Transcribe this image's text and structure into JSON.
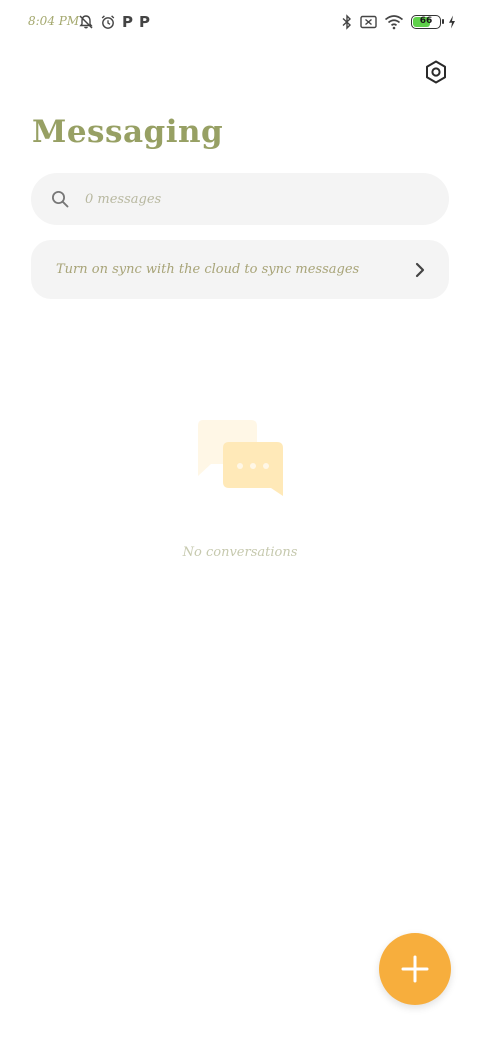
{
  "status_bar": {
    "time": "8:04 PM",
    "battery_level": "66",
    "battery_fraction": 0.66,
    "left_icons": [
      "notifications-off-icon",
      "alarm-icon",
      "p-app-icon",
      "p-app-icon"
    ],
    "right_icons": [
      "bluetooth-icon",
      "no-sim-icon",
      "wifi-icon",
      "battery-icon",
      "charging-icon"
    ]
  },
  "header": {
    "title": "Messaging",
    "settings_icon": "settings-hexagon-icon"
  },
  "search": {
    "placeholder": "0 messages",
    "icon": "search-icon"
  },
  "sync_banner": {
    "text": "Turn on sync with the cloud to sync messages",
    "icon": "chevron-right-icon"
  },
  "empty_state": {
    "text": "No conversations",
    "icon": "chat-bubbles-icon"
  },
  "fab": {
    "icon": "plus-icon"
  },
  "colors": {
    "title": "#97a064",
    "accent": "#f7ae3d",
    "field_bg": "#f4f4f4",
    "empty_illustration_light": "#fff7e6",
    "empty_illustration_dark": "#ffe9b8"
  }
}
